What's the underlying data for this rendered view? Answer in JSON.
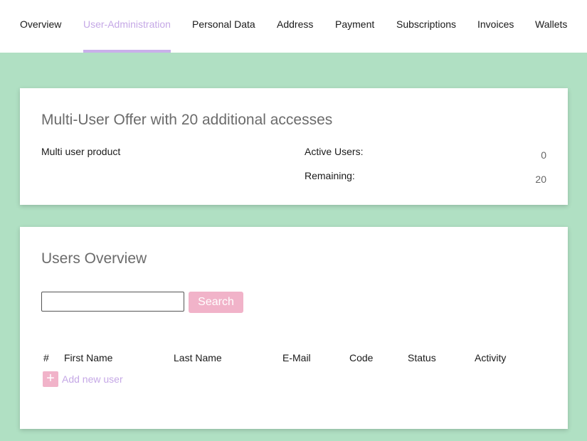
{
  "nav": {
    "tabs": [
      {
        "label": "Overview"
      },
      {
        "label": "User-Administration"
      },
      {
        "label": "Personal Data"
      },
      {
        "label": "Address"
      },
      {
        "label": "Payment"
      },
      {
        "label": "Subscriptions"
      },
      {
        "label": "Invoices"
      },
      {
        "label": "Wallets"
      }
    ],
    "active_tab": "User-Administration"
  },
  "offer": {
    "title": "Multi-User Offer with 20 additional accesses",
    "product_label": "Multi user product",
    "active_users_label": "Active Users:",
    "active_users_value": "0",
    "remaining_label": "Remaining:",
    "remaining_value": "20"
  },
  "users_overview": {
    "title": "Users Overview",
    "search": {
      "value": "",
      "button_label": "Search"
    },
    "columns": [
      "#",
      "First Name",
      "Last Name",
      "E-Mail",
      "Code",
      "Status",
      "Activity"
    ],
    "add_user_label": "Add new user",
    "add_icon": "plus-icon"
  },
  "colors": {
    "page_background": "#b0e0c3",
    "accent_purple": "#c5a8e6",
    "accent_pink": "#f1b3c9"
  }
}
